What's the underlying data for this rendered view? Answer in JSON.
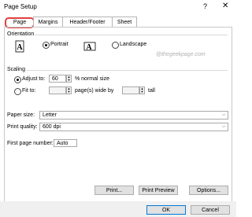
{
  "window": {
    "title": "Page Setup",
    "help": "?",
    "close": "✕"
  },
  "tabs": [
    "Page",
    "Margins",
    "Header/Footer",
    "Sheet"
  ],
  "orientation": {
    "label": "Orientation",
    "portrait": "Portrait",
    "landscape": "Landscape",
    "selected": "portrait"
  },
  "watermark": "@thegeekpage.com",
  "scaling": {
    "label": "Scaling",
    "adjust_to": "Adjust to:",
    "adjust_value": "60",
    "normal_size": "% normal size",
    "fit_to": "Fit to:",
    "fit_pages_wide": "",
    "pages_wide_by": "page(s) wide by",
    "fit_tall": "",
    "tall": "tall"
  },
  "paper_size": {
    "label": "Paper size:",
    "value": "Letter"
  },
  "print_quality": {
    "label": "Print quality:",
    "value": "600 dpi"
  },
  "first_page": {
    "label": "First page number:",
    "value": "Auto"
  },
  "buttons": {
    "print": "Print...",
    "print_preview": "Print Preview",
    "options": "Options...",
    "ok": "OK",
    "cancel": "Cancel"
  }
}
